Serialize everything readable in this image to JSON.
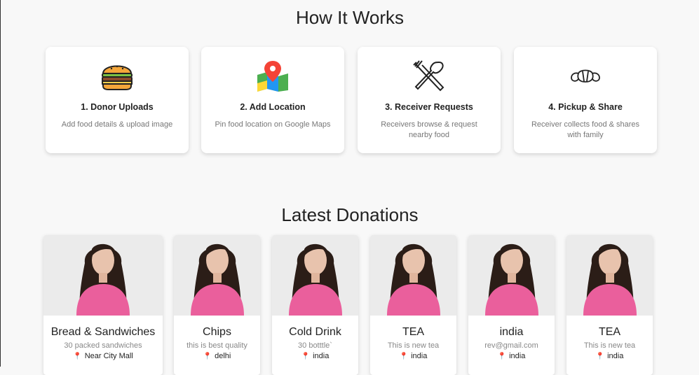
{
  "how_it_works": {
    "title": "How It Works",
    "steps": [
      {
        "icon": "burger-icon",
        "title": "1. Donor Uploads",
        "desc": "Add food details & upload image"
      },
      {
        "icon": "map-pin-icon",
        "title": "2. Add Location",
        "desc": "Pin food location on Google Maps"
      },
      {
        "icon": "fork-spoon-icon",
        "title": "3. Receiver Requests",
        "desc": "Receivers browse & request nearby food"
      },
      {
        "icon": "croissant-icon",
        "title": "4. Pickup & Share",
        "desc": "Receiver collects food & shares with family"
      }
    ]
  },
  "latest_donations": {
    "title": "Latest Donations",
    "cards": [
      {
        "name": "Bread & Sandwiches",
        "desc": "30 packed sandwiches",
        "location": "Near City Mall"
      },
      {
        "name": "Chips",
        "desc": "this is best quality",
        "location": "delhi"
      },
      {
        "name": "Cold Drink",
        "desc": "30 botttle`",
        "location": "india"
      },
      {
        "name": "TEA",
        "desc": "This is new tea",
        "location": "india"
      },
      {
        "name": "india",
        "desc": "rev@gmail.com",
        "location": "india"
      },
      {
        "name": "TEA",
        "desc": "This is new tea",
        "location": "india"
      }
    ]
  },
  "colors": {
    "accent_pin": "#e0457b",
    "card_bg": "#ffffff",
    "page_bg": "#f8f8f8"
  }
}
